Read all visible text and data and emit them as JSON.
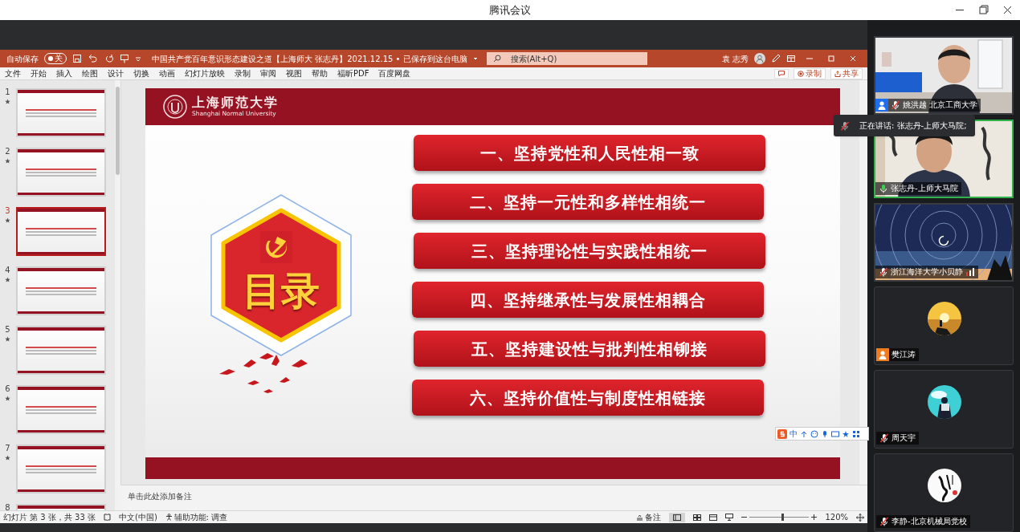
{
  "app": {
    "title": "腾讯会议"
  },
  "ppt": {
    "autosave_label": "自动保存",
    "autosave": {
      "on": false,
      "label": "关"
    },
    "document_title": "中国共产党百年意识形态建设之道【上海师大 张志丹】2021.12.15 • 已保存到这台电脑",
    "search_placeholder": "搜索(Alt+Q)",
    "user": "袁 志秀",
    "ribbon_tabs": [
      "文件",
      "开始",
      "插入",
      "绘图",
      "设计",
      "切换",
      "动画",
      "幻灯片放映",
      "录制",
      "审阅",
      "视图",
      "帮助",
      "福昕PDF",
      "百度网盘"
    ],
    "record_button": "录制",
    "share_button": "共享"
  },
  "thumbnails": [
    {
      "number": "1",
      "selected": false
    },
    {
      "number": "2",
      "selected": false
    },
    {
      "number": "3",
      "selected": true
    },
    {
      "number": "4",
      "selected": false
    },
    {
      "number": "5",
      "selected": false
    },
    {
      "number": "6",
      "selected": false
    },
    {
      "number": "7",
      "selected": false
    },
    {
      "number": "8",
      "selected": false
    }
  ],
  "slide": {
    "university_name": "上海师范大学",
    "university_name_en": "Shanghai Normal University",
    "title": "目录",
    "items": [
      "一、坚持党性和人民性相一致",
      "二、坚持一元性和多样性相统一",
      "三、坚持理论性与实践性相统一",
      "四、坚持继承性与发展性相耦合",
      "五、坚持建设性与批判性相铆接",
      "六、坚持价值性与制度性相链接"
    ]
  },
  "ime": {
    "mode": "中"
  },
  "notes_placeholder": "单击此处添加备注",
  "status_bar": {
    "slide_info": "幻灯片 第 3 张，共 33 张",
    "language": "中文(中国)",
    "accessibility": "辅助功能: 调查",
    "notes": "备注",
    "zoom": "120%",
    "zoom_slider": {
      "level": 0.55
    }
  },
  "speaker_tooltip": "正在讲话: 张志丹-上师大马院;",
  "participants": [
    {
      "name": "姚洪越 北京工商大学",
      "kind": "video",
      "color": "#1e6ff0",
      "muted": true,
      "speaking": false,
      "loading": false
    },
    {
      "name": "张志丹-上师大马院",
      "kind": "video",
      "muted": false,
      "speaking": true,
      "loading": false
    },
    {
      "name": "浙江海洋大学小贝静",
      "kind": "stars",
      "muted": true,
      "speaking": false,
      "loading": true
    },
    {
      "name": "樊江涛",
      "kind": "avatar",
      "color": "#f07c1e",
      "speaking": false,
      "loading": false
    },
    {
      "name": "周天宇",
      "kind": "avatar",
      "muted": true,
      "speaking": false,
      "loading": false
    },
    {
      "name": "李静-北京机械局党校",
      "kind": "avatar",
      "muted": true,
      "speaking": false,
      "loading": false
    }
  ]
}
